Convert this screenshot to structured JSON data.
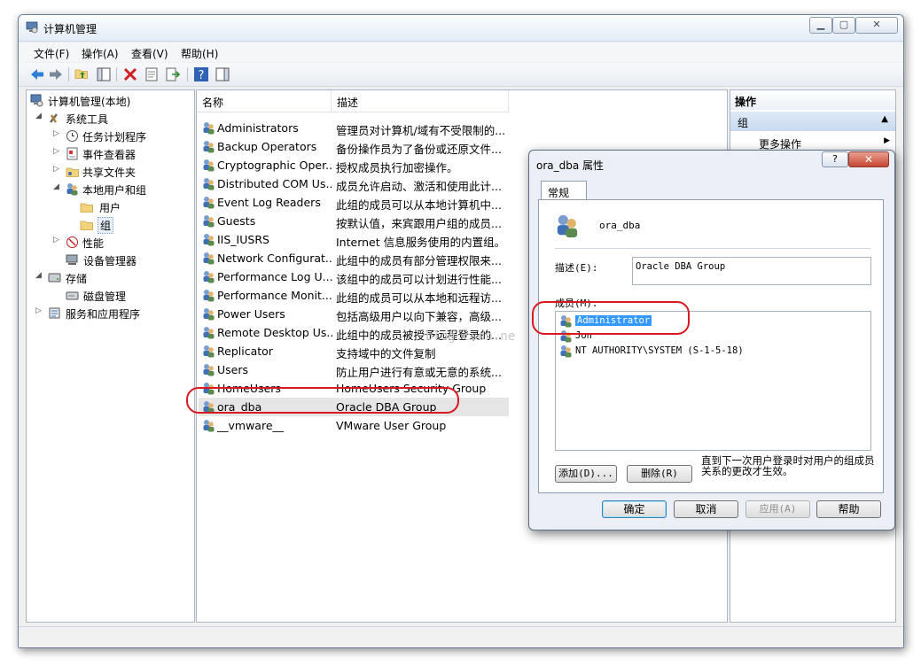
{
  "window": {
    "title": "计算机管理"
  },
  "menu": [
    {
      "label": "文件(F)"
    },
    {
      "label": "操作(A)"
    },
    {
      "label": "查看(V)"
    },
    {
      "label": "帮助(H)"
    }
  ],
  "toolbar_icons": [
    "back-arrow-icon",
    "forward-arrow-icon",
    "up-folder-icon",
    "show-tree-icon",
    "delete-icon",
    "properties-icon",
    "export-icon",
    "help-icon",
    "action-pane-icon"
  ],
  "tree": [
    {
      "label": "计算机管理(本地)",
      "icon": "computer-icon"
    },
    {
      "label": "系统工具",
      "icon": "tools-icon"
    },
    {
      "label": "任务计划程序",
      "icon": "clock-icon"
    },
    {
      "label": "事件查看器",
      "icon": "event-viewer-icon"
    },
    {
      "label": "共享文件夹",
      "icon": "shared-folder-icon"
    },
    {
      "label": "本地用户和组",
      "icon": "users-icon"
    },
    {
      "label": "用户",
      "icon": "folder-icon"
    },
    {
      "label": "组",
      "icon": "folder-icon"
    },
    {
      "label": "性能",
      "icon": "performance-icon"
    },
    {
      "label": "设备管理器",
      "icon": "device-manager-icon"
    },
    {
      "label": "存储",
      "icon": "storage-icon"
    },
    {
      "label": "磁盘管理",
      "icon": "disk-icon"
    },
    {
      "label": "服务和应用程序",
      "icon": "services-icon"
    }
  ],
  "list": {
    "columns": [
      "名称",
      "描述"
    ],
    "rows": [
      {
        "name": "Administrators",
        "desc": "管理员对计算机/域有不受限制的..."
      },
      {
        "name": "Backup Operators",
        "desc": "备份操作员为了备份或还原文件..."
      },
      {
        "name": "Cryptographic Oper...",
        "desc": "授权成员执行加密操作。"
      },
      {
        "name": "Distributed COM Us...",
        "desc": "成员允许启动、激活和使用此计..."
      },
      {
        "name": "Event Log Readers",
        "desc": "此组的成员可以从本地计算机中..."
      },
      {
        "name": "Guests",
        "desc": "按默认值，来宾跟用户组的成员..."
      },
      {
        "name": "IIS_IUSRS",
        "desc": "Internet 信息服务使用的内置组。"
      },
      {
        "name": "Network Configurat...",
        "desc": "此组中的成员有部分管理权限来..."
      },
      {
        "name": "Performance Log U...",
        "desc": "该组中的成员可以计划进行性能..."
      },
      {
        "name": "Performance Monit...",
        "desc": "此组的成员可以从本地和远程访..."
      },
      {
        "name": "Power Users",
        "desc": "包括高级用户以向下兼容，高级..."
      },
      {
        "name": "Remote Desktop Us...",
        "desc": "此组中的成员被授予远程登录的..."
      },
      {
        "name": "Replicator",
        "desc": "支持域中的文件复制"
      },
      {
        "name": "Users",
        "desc": "防止用户进行有意或无意的系统..."
      },
      {
        "name": "HomeUsers",
        "desc": "HomeUsers Security Group"
      },
      {
        "name": "ora_dba",
        "desc": "Oracle DBA Group"
      },
      {
        "name": "__vmware__",
        "desc": "VMware User Group"
      }
    ]
  },
  "actions": {
    "header": "操作",
    "group": "组",
    "more": "更多操作"
  },
  "dialog": {
    "title": "ora_dba 属性",
    "help": "?",
    "tab": "常规",
    "group_name": "ora_dba",
    "desc_label": "描述(E):",
    "desc_value": "Oracle DBA Group",
    "members_label": "成员(M):",
    "members": [
      {
        "name": "Administrator"
      },
      {
        "name": "Jon"
      },
      {
        "name": "NT AUTHORITY\\SYSTEM (S-1-5-18)"
      }
    ],
    "add_button": "添加(D)...",
    "remove_button": "删除(R)",
    "note": "直到下一次用户登录时对用户的组成员关系的更改才生效。",
    "ok": "确定",
    "cancel": "取消",
    "apply": "应用(A)",
    "helpbtn": "帮助"
  },
  "watermark": "blog.csdn.ne",
  "colors": {
    "highlight": "#3399ff",
    "annotation": "#d9181f",
    "selection": "#e6e6e6"
  }
}
